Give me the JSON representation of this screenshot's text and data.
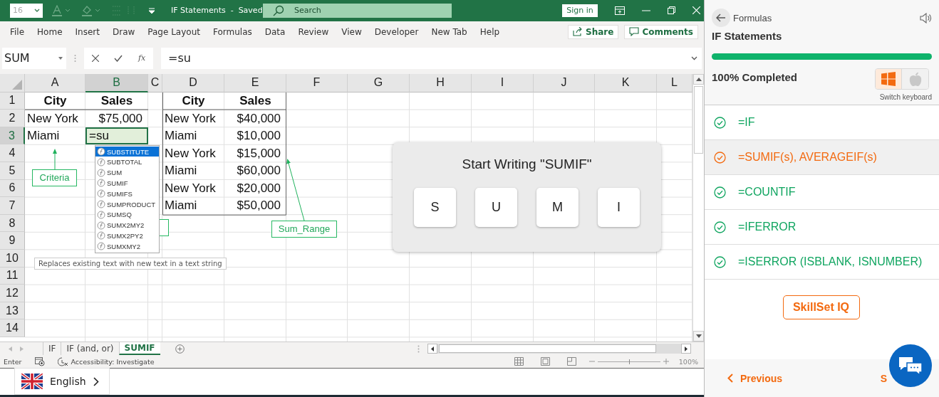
{
  "title_bar": {
    "font_size": {
      "value": "16",
      "disabled": true
    },
    "title": "IF Statements  -  Saved",
    "search": {
      "placeholder": "Search"
    },
    "sign_in": "Sign in"
  },
  "menu": [
    "File",
    "Home",
    "Insert",
    "Draw",
    "Page Layout",
    "Formulas",
    "Data",
    "Review",
    "View",
    "Developer",
    "New Tab",
    "Help"
  ],
  "share": "Share",
  "comments": "Comments",
  "formula_bar": {
    "name_box": "SUM",
    "function_label": "fx",
    "formula": "=su"
  },
  "columns": [
    {
      "label": "A",
      "selected": false
    },
    {
      "label": "B",
      "selected": true
    },
    {
      "label": "C",
      "selected": false
    },
    {
      "label": "D",
      "selected": false
    },
    {
      "label": "E",
      "selected": false
    },
    {
      "label": "F",
      "selected": false
    },
    {
      "label": "G",
      "selected": false
    },
    {
      "label": "H",
      "selected": false
    },
    {
      "label": "I",
      "selected": false
    },
    {
      "label": "J",
      "selected": false
    },
    {
      "label": "K",
      "selected": false
    },
    {
      "label": "L",
      "selected": false
    }
  ],
  "rows": [
    {
      "label": "1",
      "selected": false
    },
    {
      "label": "2",
      "selected": false
    },
    {
      "label": "3",
      "selected": true
    },
    {
      "label": "4",
      "selected": false
    },
    {
      "label": "5",
      "selected": false
    },
    {
      "label": "6",
      "selected": false
    },
    {
      "label": "7",
      "selected": false
    },
    {
      "label": "8",
      "selected": false
    },
    {
      "label": "9",
      "selected": false
    },
    {
      "label": "10",
      "selected": false
    },
    {
      "label": "11",
      "selected": false
    },
    {
      "label": "12",
      "selected": false
    },
    {
      "label": "13",
      "selected": false
    },
    {
      "label": "14",
      "selected": false
    }
  ],
  "table_1": {
    "header": [
      "City",
      "Sales"
    ],
    "rows": [
      [
        "New York",
        "$75,000"
      ],
      [
        "Miami"
      ]
    ]
  },
  "table_2": {
    "header": [
      "City",
      "Sales"
    ],
    "rows": [
      [
        "New York",
        "$40,000"
      ],
      [
        "Miami",
        "$10,000"
      ],
      [
        "New York",
        "$15,000"
      ],
      [
        "Miami",
        "$60,000"
      ],
      [
        "New York",
        "$20,000"
      ],
      [
        "Miami",
        "$50,000"
      ]
    ]
  },
  "active_cell": {
    "value": "=su"
  },
  "autocomplete": {
    "items": [
      {
        "label": "SUBSTITUTE",
        "selected": true
      },
      {
        "label": "SUBTOTAL",
        "selected": false
      },
      {
        "label": "SUM",
        "selected": false
      },
      {
        "label": "SUMIF",
        "selected": false
      },
      {
        "label": "SUMIFS",
        "selected": false
      },
      {
        "label": "SUMPRODUCT",
        "selected": false
      },
      {
        "label": "SUMSQ",
        "selected": false
      },
      {
        "label": "SUMX2MY2",
        "selected": false
      },
      {
        "label": "SUMX2PY2",
        "selected": false
      },
      {
        "label": "SUMXMY2",
        "selected": false
      }
    ],
    "tooltip": "Replaces existing text with new text in a text string"
  },
  "callouts": [
    "Criteria",
    "Sum_Range"
  ],
  "prompt": {
    "title": "Start Writing \"SUMIF\"",
    "keys": [
      "S",
      "U",
      "M",
      "I"
    ]
  },
  "sheet_tabs": [
    {
      "label": "IF",
      "selected": false
    },
    {
      "label": "IF (and, or)",
      "selected": false
    },
    {
      "label": "SUMIF",
      "selected": true
    }
  ],
  "status_bar": {
    "mode": "Enter",
    "accessibility": "Accessibility: Investigate",
    "zoom": "100%",
    "zoom_slider": {
      "level": 0.5
    }
  },
  "language": "English",
  "panel": {
    "breadcrumb": "Formulas",
    "title": "IF Statements",
    "progress": {
      "level": 1
    },
    "progress_label": "100% Completed",
    "keyboard": {
      "options": [
        {
          "kind": "windows",
          "selected": true
        },
        {
          "kind": "apple",
          "selected": false
        }
      ],
      "label": "Switch keyboard"
    },
    "lessons": [
      {
        "label": "=IF",
        "selected": false
      },
      {
        "label": "=SUMIF(s), AVERAGEIF(s)",
        "selected": true
      },
      {
        "label": "=COUNTIF",
        "selected": false
      },
      {
        "label": "=IFERROR",
        "selected": false
      },
      {
        "label": "=ISERROR (ISBLANK, ISNUMBER)",
        "selected": false
      }
    ],
    "skillset": "SkillSet IQ",
    "previous": "Previous",
    "next": "S"
  }
}
